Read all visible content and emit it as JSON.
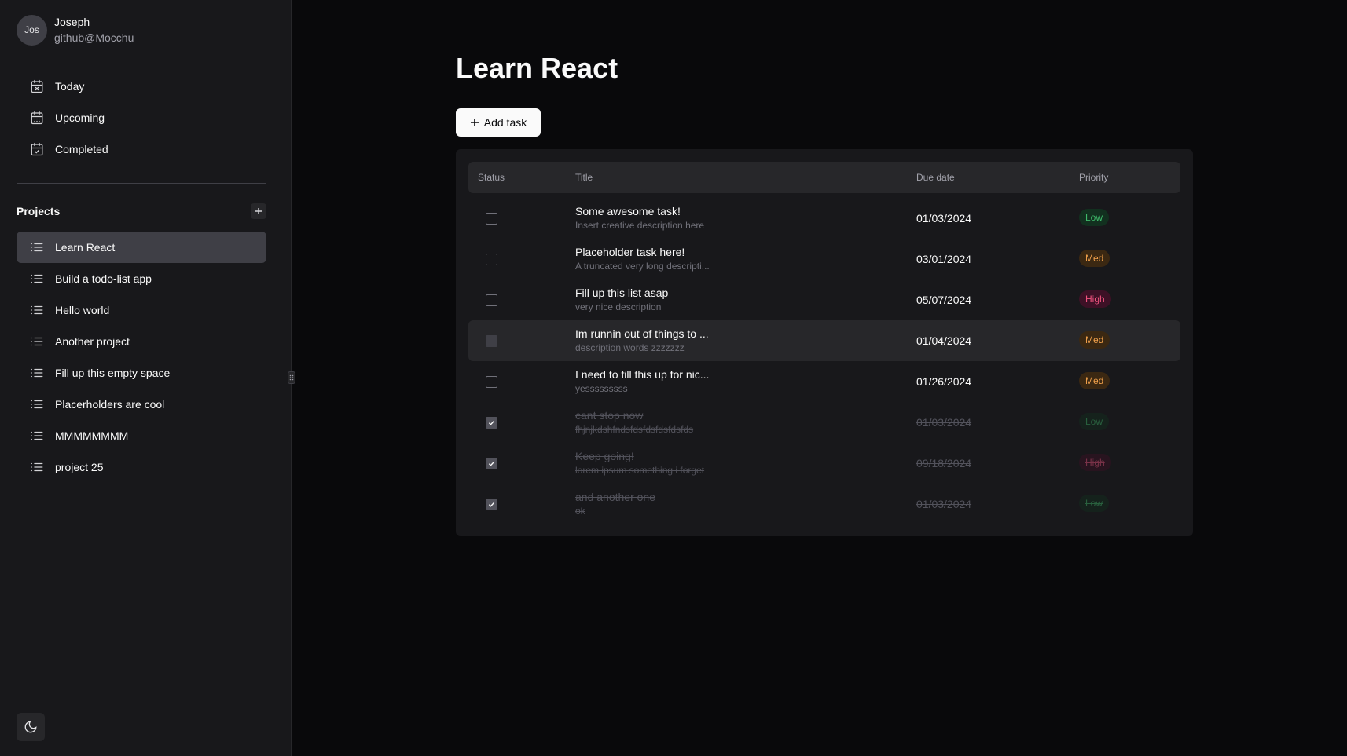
{
  "user": {
    "avatar": "Jos",
    "name": "Joseph",
    "handle": "github@Mocchu"
  },
  "nav": [
    {
      "label": "Today",
      "icon": "calendar-x-icon"
    },
    {
      "label": "Upcoming",
      "icon": "calendar-grid-icon"
    },
    {
      "label": "Completed",
      "icon": "calendar-check-icon"
    }
  ],
  "projects": {
    "title": "Projects",
    "items": [
      {
        "label": "Learn React",
        "active": true
      },
      {
        "label": "Build a todo-list app"
      },
      {
        "label": "Hello world"
      },
      {
        "label": "Another project"
      },
      {
        "label": "Fill up this empty space"
      },
      {
        "label": "Placerholders are cool"
      },
      {
        "label": "MMMMMMMM"
      },
      {
        "label": "project 25"
      }
    ]
  },
  "page": {
    "title": "Learn React",
    "add_task_label": "Add task"
  },
  "table": {
    "headers": {
      "status": "Status",
      "title": "Title",
      "due": "Due date",
      "priority": "Priority"
    },
    "rows": [
      {
        "title": "Some awesome task!",
        "desc": "Insert creative description here",
        "due": "01/03/2024",
        "priority": "Low",
        "done": false
      },
      {
        "title": "Placeholder task here!",
        "desc": "A truncated very long descripti...",
        "due": "03/01/2024",
        "priority": "Med",
        "done": false
      },
      {
        "title": "Fill up this list asap",
        "desc": "very nice description",
        "due": "05/07/2024",
        "priority": "High",
        "done": false
      },
      {
        "title": "Im runnin out of things to ...",
        "desc": "description words zzzzzzz",
        "due": "01/04/2024",
        "priority": "Med",
        "done": false,
        "hover": true
      },
      {
        "title": "I need to fill this up for nic...",
        "desc": "yesssssssss",
        "due": "01/26/2024",
        "priority": "Med",
        "done": false
      },
      {
        "title": "cant stop now",
        "desc": "fhjnjkdshfndsfdsfdsfdsfdsfds",
        "due": "01/03/2024",
        "priority": "Low",
        "done": true
      },
      {
        "title": "Keep going!",
        "desc": "lorem ipsum something i forget",
        "due": "09/18/2024",
        "priority": "High",
        "done": true
      },
      {
        "title": "and another one",
        "desc": "ok",
        "due": "01/03/2024",
        "priority": "Low",
        "done": true
      }
    ]
  },
  "colors": {
    "low_bg": "#12301f",
    "low_fg": "#3fb96a",
    "med_bg": "#3b2812",
    "med_fg": "#f0a04b",
    "high_bg": "#3d1126",
    "high_fg": "#f0537f"
  }
}
